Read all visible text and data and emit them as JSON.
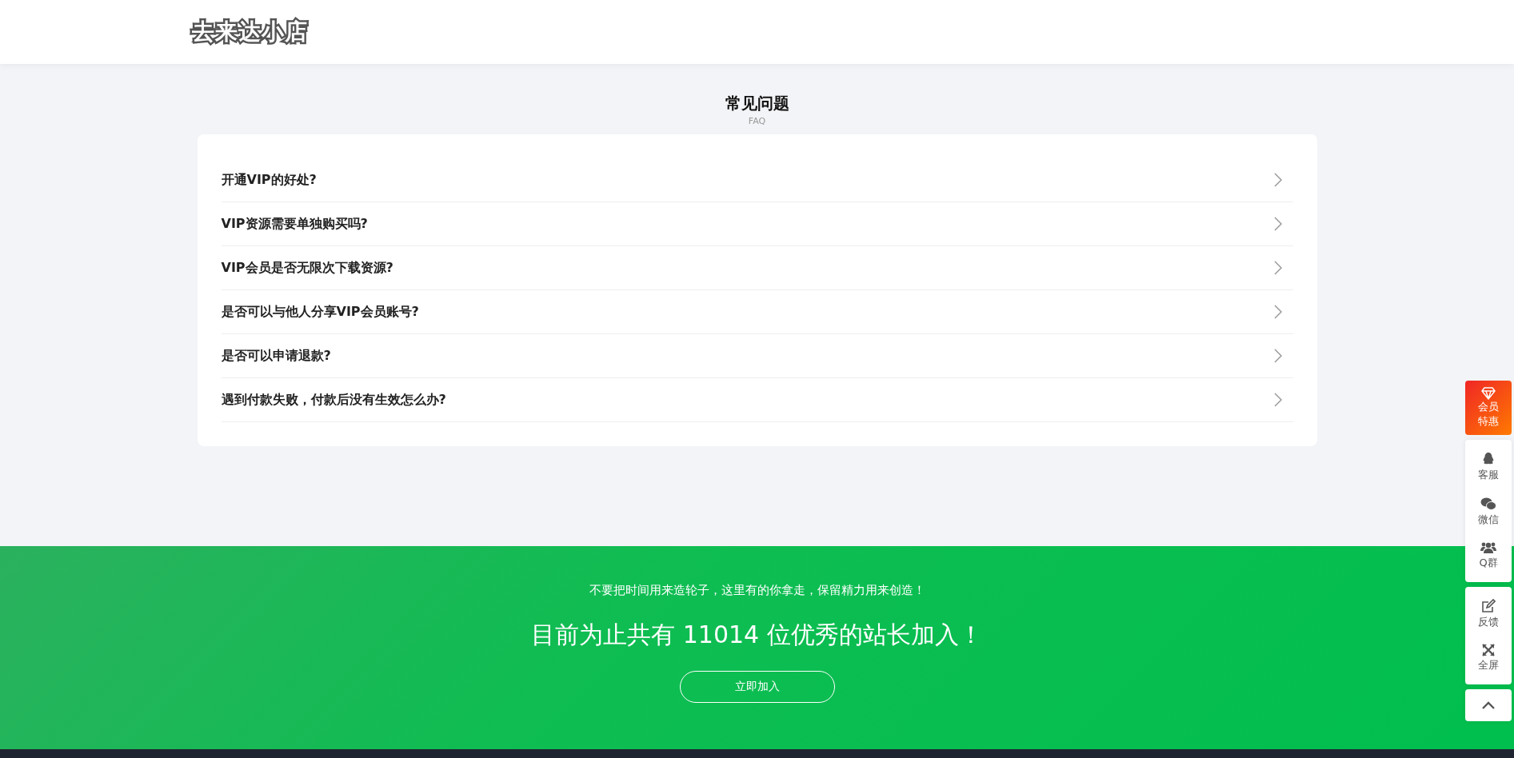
{
  "header": {
    "logo": "去来达小店"
  },
  "faq": {
    "title": "常见问题",
    "subtitle": "FAQ",
    "items": [
      {
        "question": "开通VIP的好处?",
        "expanded": false
      },
      {
        "question": "VIP资源需要单独购买吗?",
        "expanded": false
      },
      {
        "question": "VIP会员是否无限次下载资源?",
        "expanded": false
      },
      {
        "question": "是否可以与他人分享VIP会员账号?",
        "expanded": false
      },
      {
        "question": "是否可以申请退款?",
        "expanded": false
      },
      {
        "question": "遇到付款失败，付款后没有生效怎么办?",
        "expanded": false
      }
    ]
  },
  "join": {
    "slogan": "不要把时间用来造轮子，这里有的你拿走，保留精力用来创造！",
    "headline": "目前为止共有 11014 位优秀的站长加入！",
    "button": "立即加入"
  },
  "sidebar": {
    "promo": {
      "label": "会员特惠"
    },
    "groups": [
      [
        {
          "kind": "qq",
          "label": "客服"
        },
        {
          "kind": "wechat",
          "label": "微信"
        },
        {
          "kind": "group",
          "label": "Q群"
        }
      ],
      [
        {
          "kind": "feedback",
          "label": "反馈"
        },
        {
          "kind": "fullscreen",
          "label": "全屏"
        }
      ]
    ]
  }
}
